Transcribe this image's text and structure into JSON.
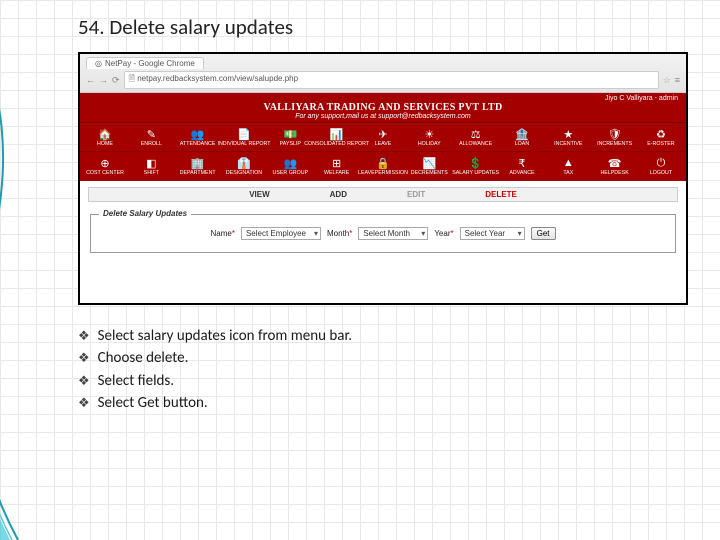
{
  "slide": {
    "title": "54. Delete salary updates"
  },
  "browser": {
    "tab_title": "NetPay - Google Chrome",
    "url": "netpay.redbacksystem.com/view/salupde.php"
  },
  "header": {
    "company": "VALLIYARA TRADING AND SERVICES PVT LTD",
    "support": "For any support,mail us at support@redbacksystem.com",
    "user": "Jiyo C Valliyara - admin"
  },
  "menu_row1": [
    {
      "icon": "🏠",
      "label": "HOME"
    },
    {
      "icon": "✎",
      "label": "ENROLL"
    },
    {
      "icon": "👥",
      "label": "ATTENDANCE"
    },
    {
      "icon": "📄",
      "label": "INDIVIDUAL REPORT"
    },
    {
      "icon": "💵",
      "label": "PAYSLIP"
    },
    {
      "icon": "📊",
      "label": "CONSOLIDATED REPORT"
    },
    {
      "icon": "✈",
      "label": "LEAVE"
    },
    {
      "icon": "☀",
      "label": "HOLIDAY"
    },
    {
      "icon": "⚖",
      "label": "ALLOWANCE"
    },
    {
      "icon": "🏦",
      "label": "LOAN"
    },
    {
      "icon": "★",
      "label": "INCENTIVE"
    },
    {
      "icon": "🛡",
      "label": "INCREMENTS"
    },
    {
      "icon": "♻",
      "label": "E-ROSTER"
    }
  ],
  "menu_row2": [
    {
      "icon": "⊕",
      "label": "COST CENTER"
    },
    {
      "icon": "◧",
      "label": "SHIFT"
    },
    {
      "icon": "🏢",
      "label": "DEPARTMENT"
    },
    {
      "icon": "👔",
      "label": "DESIGNATION"
    },
    {
      "icon": "👥",
      "label": "USER GROUP"
    },
    {
      "icon": "⊞",
      "label": "WELFARE"
    },
    {
      "icon": "🔒",
      "label": "LEAVEPERMISSION"
    },
    {
      "icon": "📉",
      "label": "DECREMENTS"
    },
    {
      "icon": "💲",
      "label": "SALARY UPDATES"
    },
    {
      "icon": "₹",
      "label": "ADVANCE"
    },
    {
      "icon": "▲",
      "label": "TAX"
    },
    {
      "icon": "☎",
      "label": "HELPDESK"
    },
    {
      "icon": "⏻",
      "label": "LOGOUT"
    }
  ],
  "actions": {
    "view": "VIEW",
    "add": "ADD",
    "edit": "EDIT",
    "delete": "DELETE"
  },
  "form": {
    "legend": "Delete Salary Updates",
    "name_label": "Name",
    "name_value": "Select Employee",
    "month_label": "Month",
    "month_value": "Select Month",
    "year_label": "Year",
    "year_value": "Select Year",
    "button": "Get"
  },
  "bullets": [
    "Select salary updates icon from menu bar.",
    "Choose delete.",
    "Select fields.",
    "Select Get button."
  ]
}
